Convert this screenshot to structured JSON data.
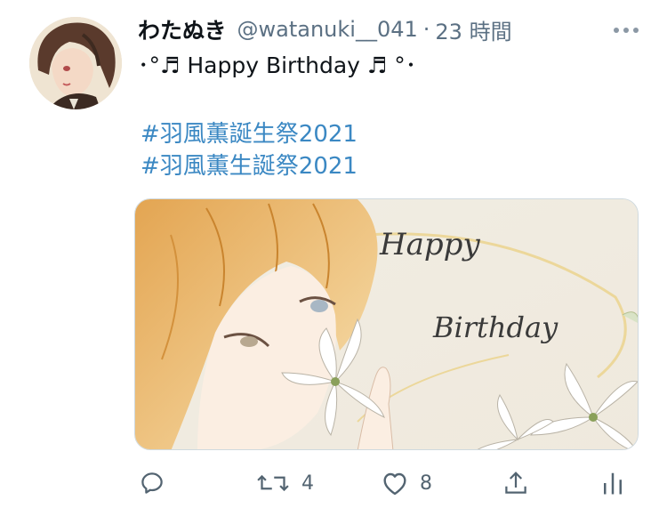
{
  "tweet": {
    "display_name": "わたぬき",
    "handle": "@watanuki__041",
    "separator": "·",
    "timestamp": "23 時間",
    "text": "･°♬ Happy Birthday ♬ °･",
    "hashtags": [
      "#羽風薫誕生祭2021",
      "#羽風薫生誕祭2021"
    ],
    "image": {
      "script_text": [
        "Happy",
        "Birthday"
      ]
    }
  },
  "actions": {
    "reply": {
      "icon": "reply-icon",
      "count": ""
    },
    "retweet": {
      "icon": "retweet-icon",
      "count": "4"
    },
    "like": {
      "icon": "heart-icon",
      "count": "8"
    },
    "share": {
      "icon": "share-icon",
      "count": ""
    },
    "analytics": {
      "icon": "analytics-icon",
      "count": ""
    }
  },
  "colors": {
    "hashtag": "#3b88c3",
    "secondary_text": "#5b7083",
    "icon": "#536471"
  }
}
